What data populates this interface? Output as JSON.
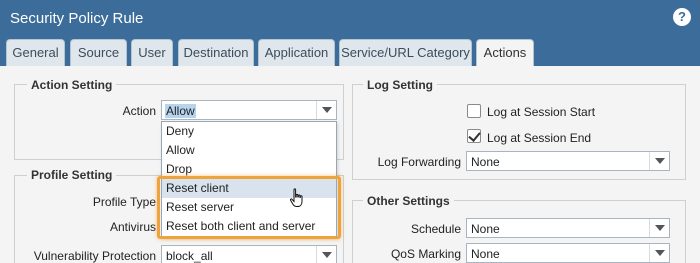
{
  "window": {
    "title": "Security Policy Rule",
    "help_icon": "?"
  },
  "tabs": [
    {
      "label": "General"
    },
    {
      "label": "Source"
    },
    {
      "label": "User"
    },
    {
      "label": "Destination"
    },
    {
      "label": "Application"
    },
    {
      "label": "Service/URL Category"
    },
    {
      "label": "Actions"
    }
  ],
  "active_tab": "Actions",
  "action_setting": {
    "legend": "Action Setting",
    "action_label": "Action",
    "action_value": "Allow"
  },
  "action_dropdown": {
    "options": [
      "Deny",
      "Allow",
      "Drop",
      "Reset client",
      "Reset server",
      "Reset both client and server"
    ],
    "hovered": "Reset client"
  },
  "profile_setting": {
    "legend": "Profile Setting",
    "profile_type_label": "Profile Type",
    "antivirus_label": "Antivirus",
    "vuln_label": "Vulnerability Protection",
    "vuln_value": "block_all"
  },
  "log_setting": {
    "legend": "Log Setting",
    "log_start_label": "Log at Session Start",
    "log_start_checked": false,
    "log_end_label": "Log at Session End",
    "log_end_checked": true,
    "log_forwarding_label": "Log Forwarding",
    "log_forwarding_value": "None"
  },
  "other_settings": {
    "legend": "Other Settings",
    "schedule_label": "Schedule",
    "schedule_value": "None",
    "qos_label": "QoS Marking",
    "qos_value": "None"
  },
  "colors": {
    "header": "#3c6c9a",
    "highlight_border": "#f0a33a",
    "hover_row": "#d8e3ee"
  }
}
